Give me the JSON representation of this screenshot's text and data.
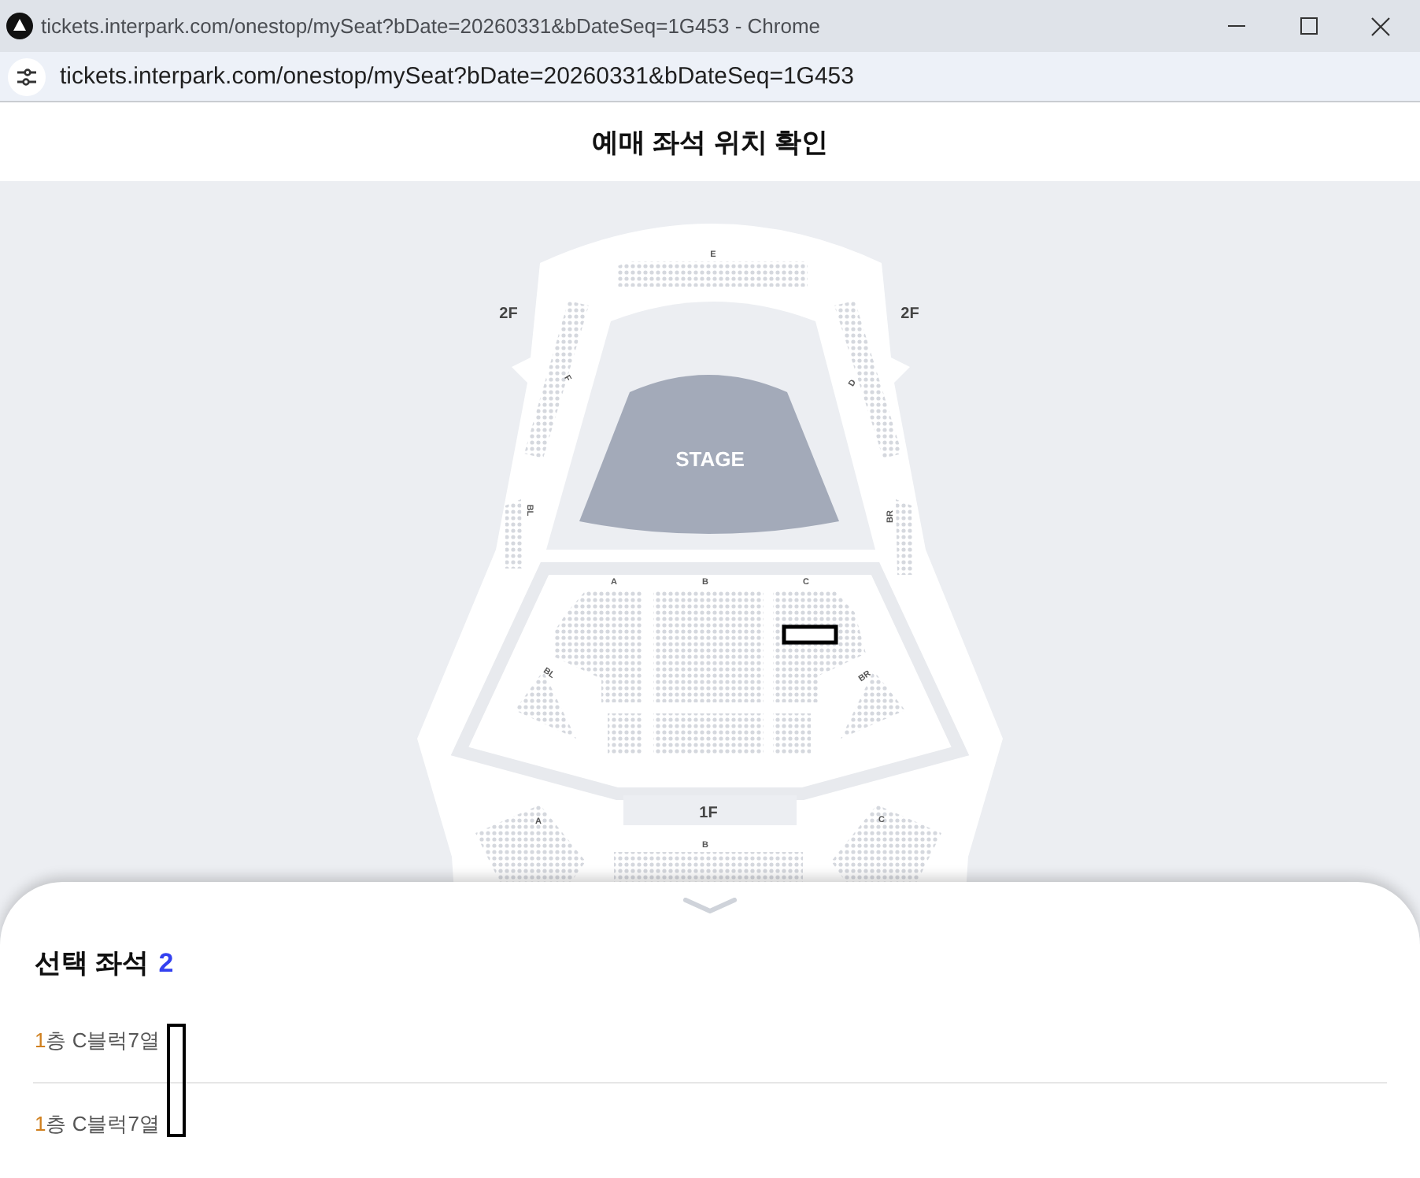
{
  "window": {
    "title": "tickets.interpark.com/onestop/mySeat?bDate=20260331&bDateSeq=1G453 - Chrome",
    "url": "tickets.interpark.com/onestop/mySeat?bDate=20260331&bDateSeq=1G453"
  },
  "header": {
    "title": "예매 좌석 위치 확인"
  },
  "seat_map": {
    "stage_label": "STAGE",
    "labels": [
      {
        "text": "E",
        "kind": "block"
      },
      {
        "text": "2F",
        "kind": "floor"
      },
      {
        "text": "2F",
        "kind": "floor"
      },
      {
        "text": "F",
        "kind": "block"
      },
      {
        "text": "D",
        "kind": "block"
      },
      {
        "text": "BL",
        "kind": "block"
      },
      {
        "text": "BR",
        "kind": "block"
      },
      {
        "text": "A",
        "kind": "block"
      },
      {
        "text": "B",
        "kind": "block"
      },
      {
        "text": "C",
        "kind": "block"
      },
      {
        "text": "BL",
        "kind": "block"
      },
      {
        "text": "BR",
        "kind": "block"
      },
      {
        "text": "1F",
        "kind": "floor"
      },
      {
        "text": "A",
        "kind": "block"
      },
      {
        "text": "B",
        "kind": "block"
      },
      {
        "text": "C",
        "kind": "block"
      }
    ]
  },
  "selection": {
    "heading": "선택 좌석",
    "count": "2",
    "seats": [
      {
        "floor": "1",
        "detail": "층 C블럭7열"
      },
      {
        "floor": "1",
        "detail": "층 C블럭7열"
      }
    ]
  }
}
